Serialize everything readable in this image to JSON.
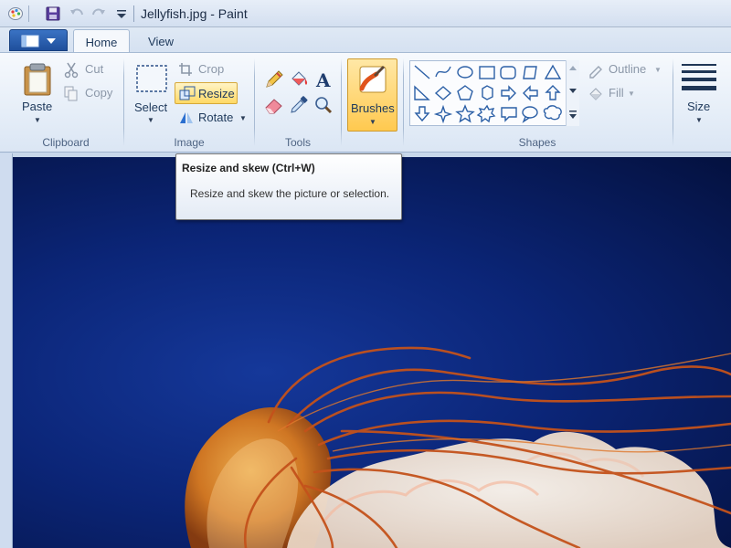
{
  "window": {
    "title": "Jellyfish.jpg - Paint"
  },
  "tabs": [
    {
      "label": "Home",
      "active": true
    },
    {
      "label": "View",
      "active": false
    }
  ],
  "ribbon": {
    "clipboard": {
      "group_label": "Clipboard",
      "paste": "Paste",
      "cut": "Cut",
      "copy": "Copy"
    },
    "image": {
      "group_label": "Image",
      "select": "Select",
      "crop": "Crop",
      "resize": "Resize",
      "rotate": "Rotate"
    },
    "tools": {
      "group_label": "Tools"
    },
    "brushes": {
      "label": "Brushes"
    },
    "shapes": {
      "group_label": "Shapes",
      "outline": "Outline",
      "fill": "Fill"
    },
    "size": {
      "label": "Size"
    }
  },
  "tooltip": {
    "title": "Resize and skew (Ctrl+W)",
    "description": "Resize and skew the picture or selection."
  },
  "colors": {
    "accent_highlight": "#ffd966",
    "app_menu": "#2a5fb0",
    "canvas_background": "#0b2577"
  }
}
